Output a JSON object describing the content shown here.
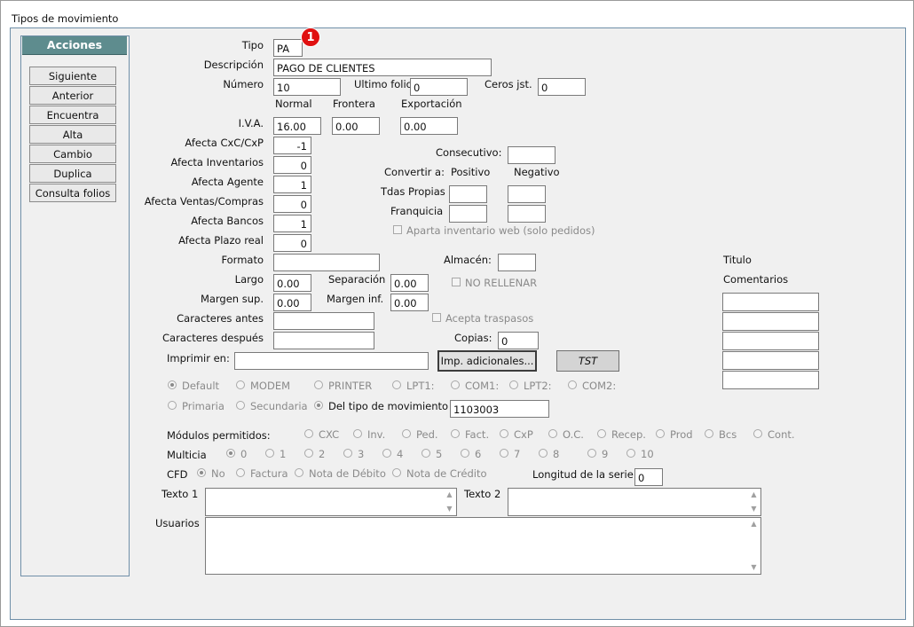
{
  "window": {
    "title": "Tipos de movimiento"
  },
  "actions": {
    "title": "Acciones",
    "buttons": [
      "Siguiente",
      "Anterior",
      "Encuentra",
      "Alta",
      "Cambio",
      "Duplica",
      "Consulta folios"
    ]
  },
  "badge": "1",
  "form": {
    "tipo_label": "Tipo",
    "tipo_value": "PA",
    "descripcion_label": "Descripción",
    "descripcion_value": "PAGO DE CLIENTES",
    "numero_label": "Número",
    "numero_value": "10",
    "ultimo_folio_label": "Ultimo folio",
    "ultimo_folio_value": "0",
    "ceros_label": "Ceros jst.",
    "ceros_value": "0",
    "iva_label": "I.V.A.",
    "iva_headers": [
      "Normal",
      "Frontera",
      "Exportación"
    ],
    "iva_values": [
      "16.00",
      "0.00",
      "0.00"
    ],
    "afecta": [
      {
        "label": "Afecta  CxC/CxP",
        "value": "-1"
      },
      {
        "label": "Afecta  Inventarios",
        "value": "0"
      },
      {
        "label": "Afecta  Agente",
        "value": "1"
      },
      {
        "label": "Afecta  Ventas/Compras",
        "value": "0"
      },
      {
        "label": "Afecta  Bancos",
        "value": "1"
      },
      {
        "label": "Afecta  Plazo real",
        "value": "0"
      }
    ],
    "consecutivo_label": "Consecutivo:",
    "convertir_label": "Convertir a:",
    "positivo_label": "Positivo",
    "negativo_label": "Negativo",
    "tdas_propias_label": "Tdas Propias",
    "franquicia_label": "Franquicia",
    "aparta_label": "Aparta inventario web (solo pedidos)",
    "formato_label": "Formato",
    "almacen_label": "Almacén:",
    "largo_label": "Largo",
    "largo_value": "0.00",
    "separacion_label": "Separación",
    "separacion_value": "0.00",
    "no_rellenar_label": "NO RELLENAR",
    "margen_sup_label": "Margen sup.",
    "margen_sup_value": "0.00",
    "margen_inf_label": "Margen inf.",
    "margen_inf_value": "0.00",
    "car_antes_label": "Caracteres antes",
    "acepta_label": "Acepta traspasos",
    "car_despues_label": "Caracteres después",
    "copias_label": "Copias:",
    "copias_value": "0",
    "imprimir_label": "Imprimir en:",
    "imp_adicionales_label": "Imp. adicionales...",
    "tst_label": "TST",
    "titulo_label": "Titulo",
    "comentarios_label": "Comentarios",
    "printer_options": [
      "Default",
      "MODEM",
      "PRINTER",
      "LPT1:",
      "COM1:",
      "LPT2:",
      "COM2:"
    ],
    "printer_selected": "Default",
    "serie_options": [
      "Primaria",
      "Secundaria",
      "Del tipo de movimiento"
    ],
    "serie_selected": "Del tipo de movimiento",
    "serie_value": "1103003",
    "modulos_label": "Módulos permitidos:",
    "modulos": [
      "CXC",
      "Inv.",
      "Ped.",
      "Fact.",
      "CxP",
      "O.C.",
      "Recep.",
      "Prod",
      "Bcs",
      "Cont."
    ],
    "multicia_label": "Multicia",
    "multicia": [
      "0",
      "1",
      "2",
      "3",
      "4",
      "5",
      "6",
      "7",
      "8",
      "9",
      "10"
    ],
    "multicia_selected": "0",
    "cfd_label": "CFD",
    "cfd_options": [
      "No",
      "Factura",
      "Nota de Débito",
      "Nota de Crédito"
    ],
    "cfd_selected": "No",
    "longitud_label": "Longitud de la serie",
    "longitud_value": "0",
    "texto1_label": "Texto 1",
    "texto2_label": "Texto 2",
    "usuarios_label": "Usuarios"
  }
}
